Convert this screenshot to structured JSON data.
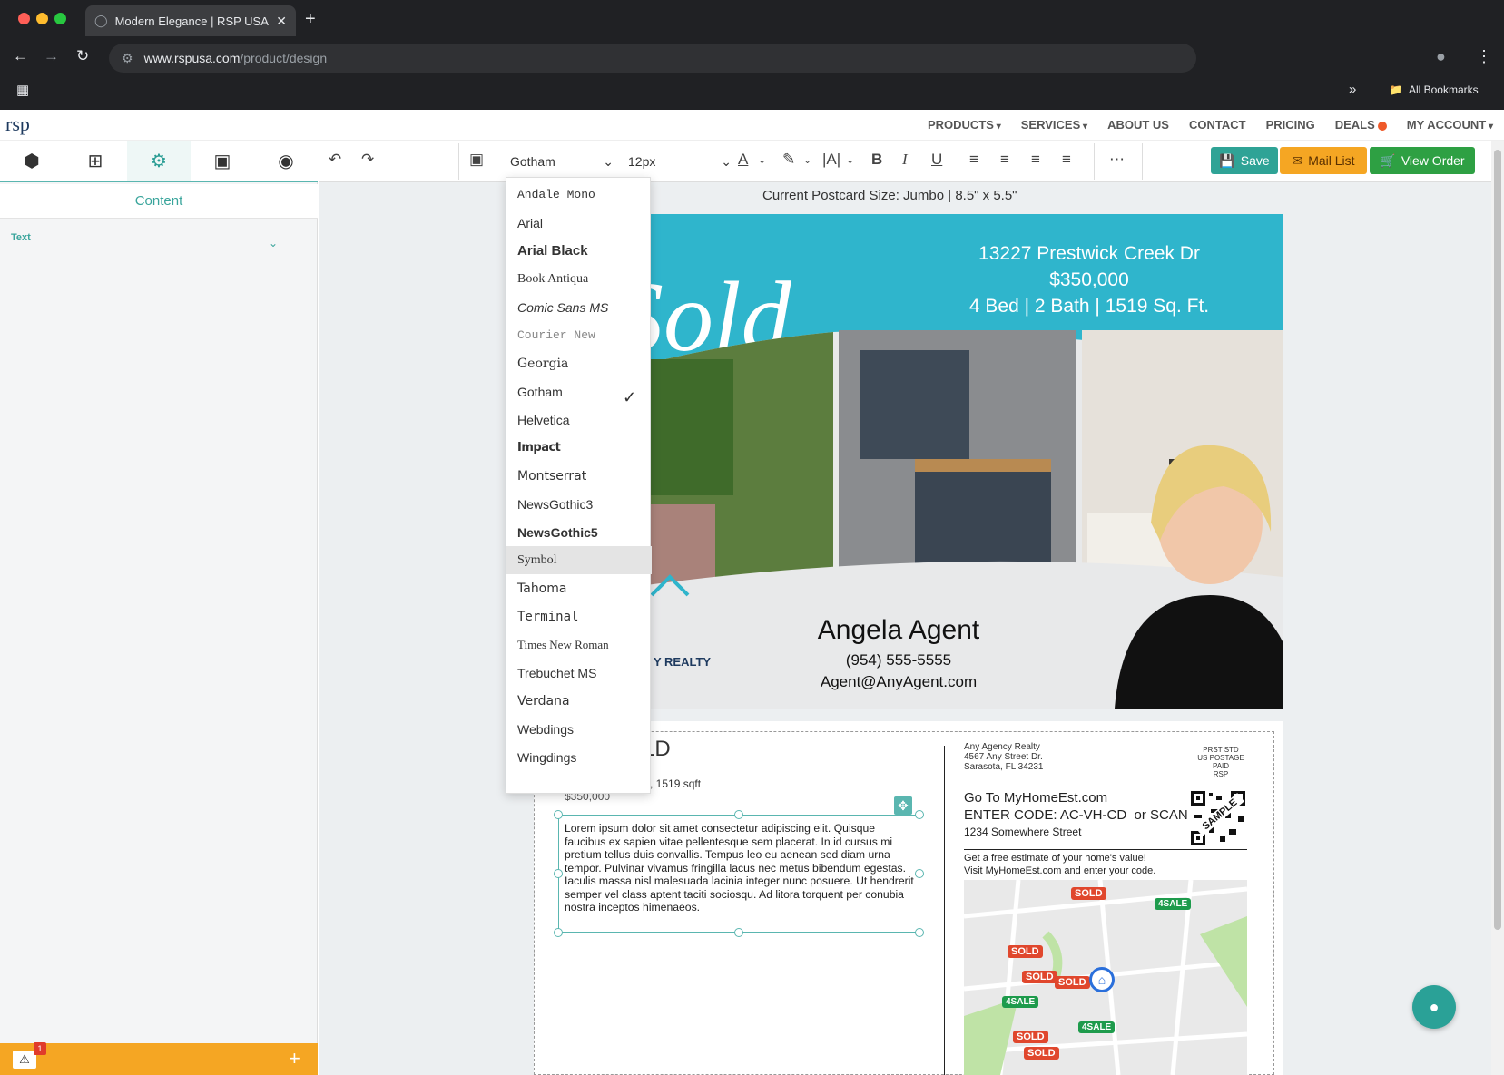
{
  "browser": {
    "tab_title": "Modern Elegance | RSP USA",
    "url_domain": "www.rspusa.com",
    "url_path": "/product/design",
    "bookmarks_label": "All Bookmarks"
  },
  "site": {
    "logo_text": "rsp",
    "nav": [
      "PRODUCTS",
      "SERVICES",
      "ABOUT US",
      "CONTACT",
      "PRICING",
      "DEALS",
      "MY ACCOUNT"
    ]
  },
  "sidebar": {
    "content_label": "Content",
    "text_section_label": "Text",
    "warning_count": "1"
  },
  "toolbar": {
    "font_value": "Gotham",
    "size_value": "12px",
    "save_label": "Save",
    "mail_list_label": "Mail List",
    "view_order_label": "View Order"
  },
  "canvas": {
    "size_info": "Current Postcard Size: Jumbo  |  8.5\" x 5.5\""
  },
  "font_menu": {
    "items": [
      "Andale Mono",
      "Arial",
      "Arial Black",
      "Book Antiqua",
      "Comic Sans MS",
      "Courier New",
      "Georgia",
      "Gotham",
      "Helvetica",
      "Impact",
      "Montserrat",
      "NewsGothic3",
      "NewsGothic5",
      "Symbol",
      "Tahoma",
      "Terminal",
      "Times New Roman",
      "Trebuchet MS",
      "Verdana",
      "Webdings",
      "Wingdings"
    ],
    "selected": "Gotham",
    "hovered": "Symbol"
  },
  "postcard_front": {
    "address": "13227 Prestwick Creek Dr",
    "price": "$350,000",
    "details": "4 Bed   |   2 Bath   |   1519 Sq. Ft.",
    "script_text": "t Sold",
    "agent_name": "Angela Agent",
    "agent_phone": "(954) 555-5555",
    "agent_email": "Agent@AnyAgent.com",
    "realty_text": "Y REALTY"
  },
  "postcard_back": {
    "heading_fragment": "LD",
    "specs_fragment": "s, 1519 sqft",
    "price": "$350,000",
    "lorem": "Lorem ipsum dolor sit amet consectetur adipiscing elit. Quisque faucibus ex sapien vitae pellentesque sem placerat. In id cursus mi pretium tellus duis convallis. Tempus leo eu aenean sed diam urna tempor. Pulvinar vivamus fringilla lacus nec metus bibendum egestas. Iaculis massa nisl malesuada lacinia integer nunc posuere. Ut hendrerit semper vel class aptent taciti sociosqu. Ad litora torquent per conubia nostra inceptos himenaeos.",
    "agency_lines": [
      "Any Agency Realty",
      "4567 Any Street Dr.",
      "Sarasota, FL 34231"
    ],
    "postage_lines": [
      "PRST STD",
      "US POSTAGE",
      "PAID",
      "RSP"
    ],
    "goto_line": "Go To MyHomeEst.com",
    "code_line": "ENTER CODE: AC-VH-CD",
    "scan_text": "or SCAN",
    "street": "1234 Somewhere Street",
    "qr_label": "SAMPLE",
    "estimate_lines": [
      "Get a free estimate of your home's value!",
      "Visit MyHomeEst.com and enter your code."
    ],
    "map_pins": [
      "SOLD",
      "4SALE",
      "SOLD",
      "SOLD",
      "SOLD",
      "4SALE",
      "4SALE",
      "SOLD",
      "SOLD"
    ]
  }
}
